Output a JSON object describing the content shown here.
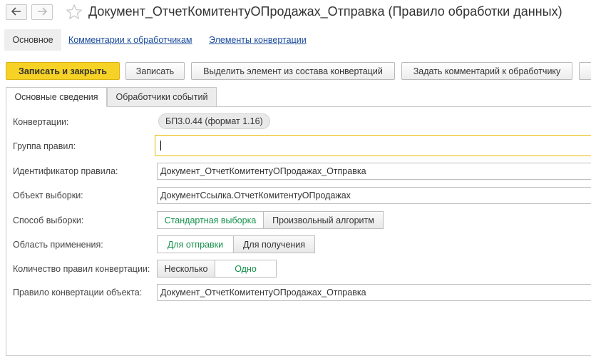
{
  "window": {
    "title": "Документ_ОтчетКомитентуОПродажах_Отправка (Правило обработки данных)",
    "back_icon": "arrow-left-icon",
    "forward_icon": "arrow-right-icon",
    "favorite_icon": "star-icon"
  },
  "nav": {
    "main_label": "Основное",
    "links": [
      "Комментарии к обработчикам",
      "Элементы конвертации"
    ]
  },
  "toolbar": {
    "save_close": "Записать и закрыть",
    "save": "Записать",
    "select_element": "Выделить элемент из состава конвертаций",
    "add_comment": "Задать комментарий к обработчику"
  },
  "tabs": [
    "Основные сведения",
    "Обработчики событий"
  ],
  "form": {
    "conversions": {
      "label": "Конвертации:",
      "tag": "БП3.0.44 (формат 1.16)"
    },
    "rule_group": {
      "label": "Группа правил:",
      "value": ""
    },
    "rule_id": {
      "label": "Идентификатор правила:",
      "value": "Документ_ОтчетКомитентуОПродажах_Отправка"
    },
    "selection_object": {
      "label": "Объект выборки:",
      "value": "ДокументСсылка.ОтчетКомитентуОПродажах"
    },
    "selection_method": {
      "label": "Способ выборки:",
      "options": [
        "Стандартная выборка",
        "Произвольный алгоритм"
      ],
      "selected": 0
    },
    "scope": {
      "label": "Область применения:",
      "options": [
        "Для отправки",
        "Для получения"
      ],
      "selected": 0
    },
    "rules_count": {
      "label": "Количество правил конвертации:",
      "options": [
        "Несколько",
        "Одно"
      ],
      "selected": 1
    },
    "object_rule": {
      "label": "Правило конвертации объекта:",
      "value": "Документ_ОтчетКомитентуОПродажах_Отправка"
    }
  },
  "colors": {
    "accent_button": "#f7d226",
    "selected_option": "#14904a",
    "link": "#1a4b9c",
    "focus_border": "#e6b800"
  }
}
